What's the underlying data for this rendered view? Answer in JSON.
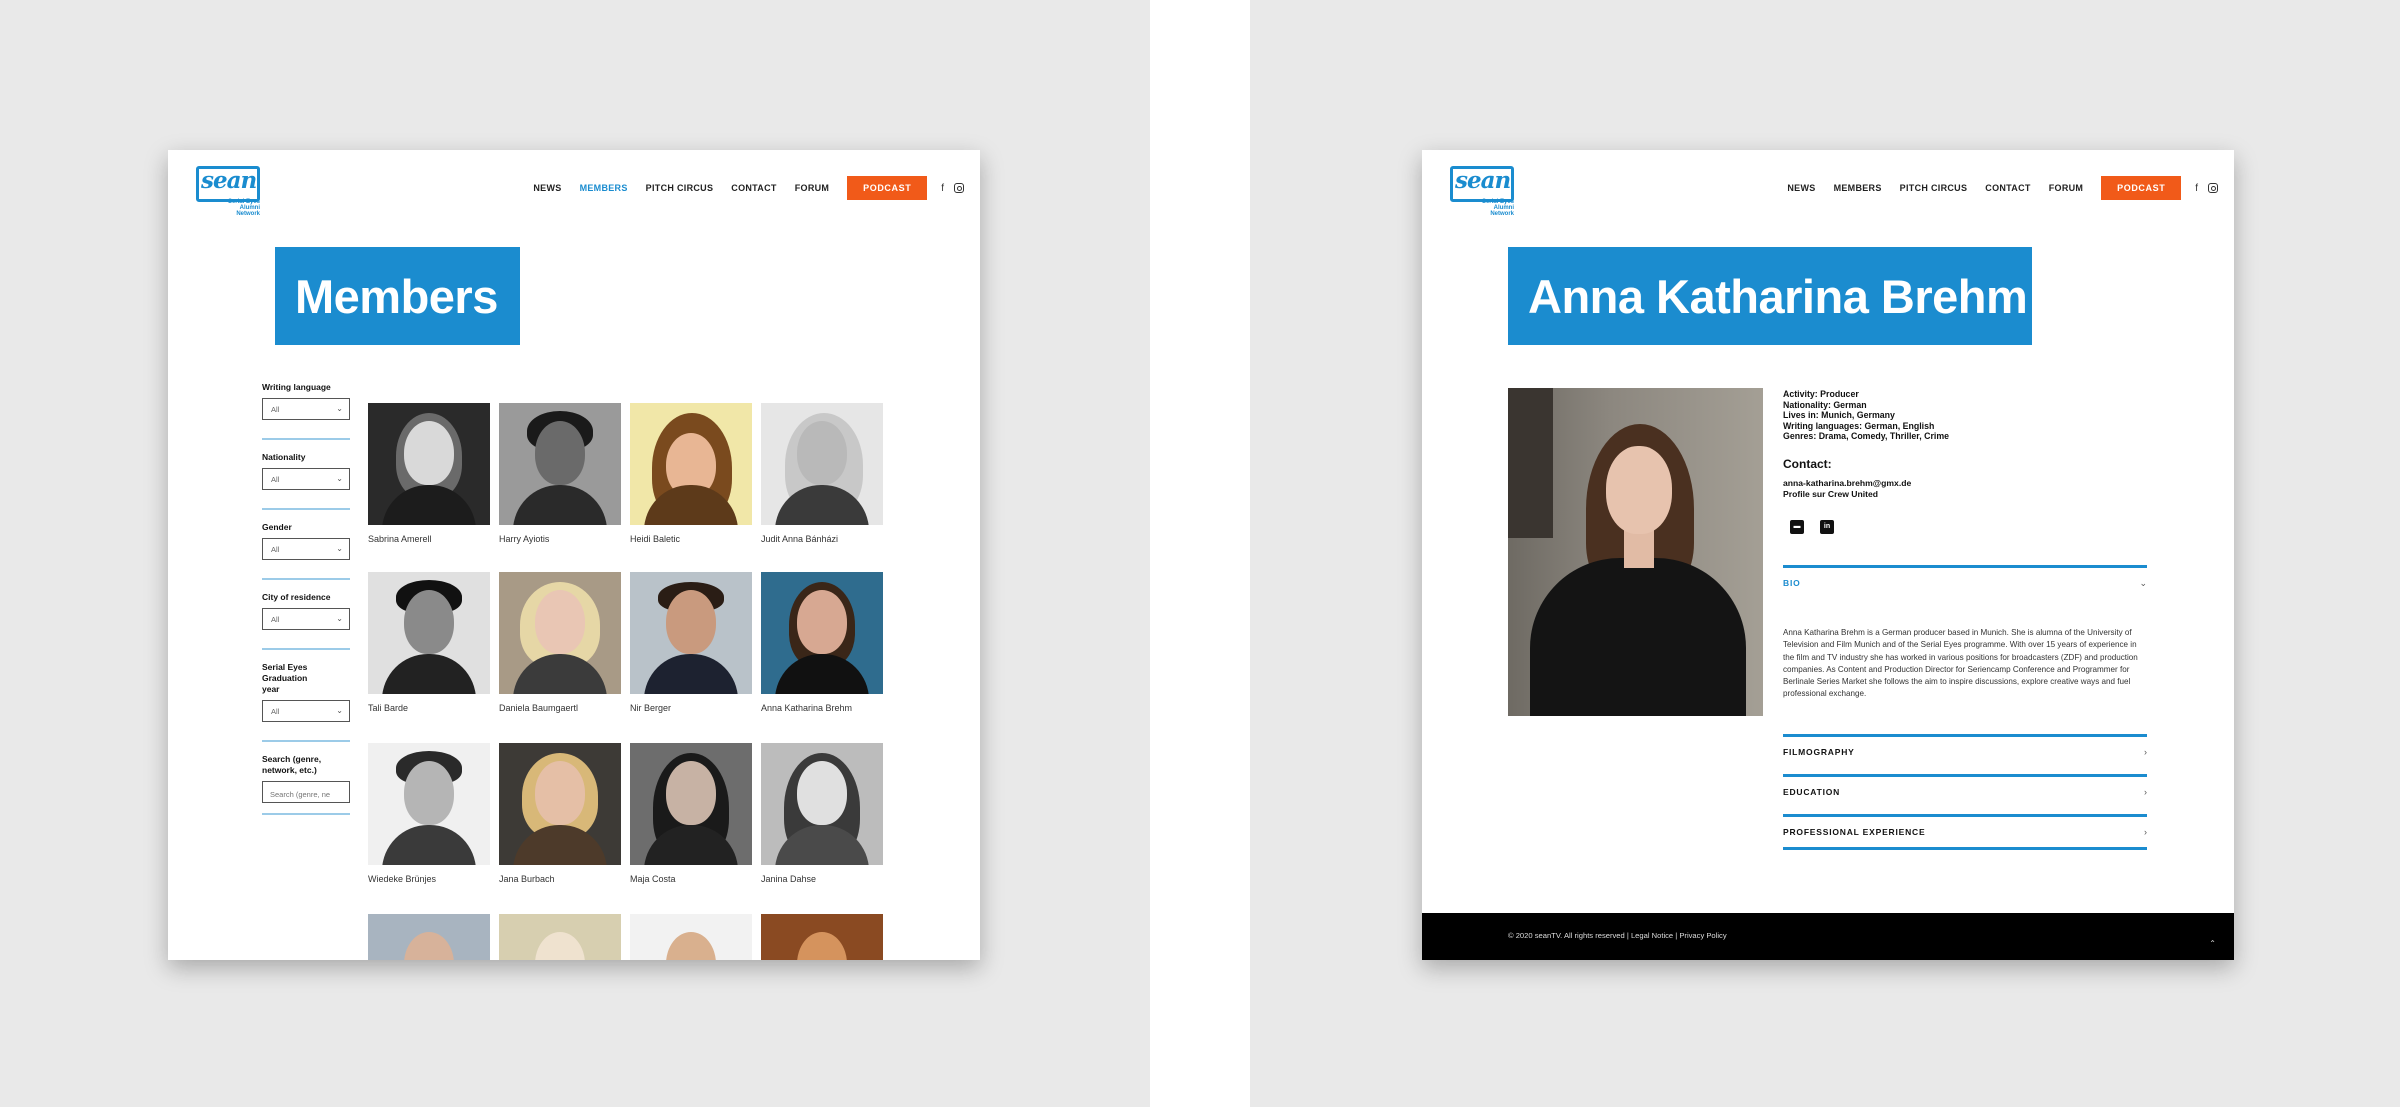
{
  "header": {
    "logo_word": "sean",
    "logo_sub": "Serial Eyes Alumni Network",
    "nav": [
      "NEWS",
      "MEMBERS",
      "PITCH CIRCUS",
      "CONTACT",
      "FORUM"
    ],
    "podcast": "PODCAST",
    "social": [
      "facebook-icon",
      "instagram-icon"
    ]
  },
  "members_page": {
    "title": "Members",
    "filters": {
      "writing_language": {
        "label": "Writing language",
        "value": "All"
      },
      "nationality": {
        "label": "Nationality",
        "value": "All"
      },
      "gender": {
        "label": "Gender",
        "value": "All"
      },
      "city": {
        "label": "City of residence",
        "value": "All"
      },
      "graduation": {
        "label": "Serial Eyes Graduation year",
        "value": "All"
      },
      "search": {
        "label": "Search (genre, network, etc.)",
        "placeholder": "Search (genre, ne"
      }
    },
    "members": [
      {
        "name": "Sabrina Amerell"
      },
      {
        "name": "Harry Ayiotis"
      },
      {
        "name": "Heidi Baletic"
      },
      {
        "name": "Judit Anna Bánházi"
      },
      {
        "name": "Tali Barde"
      },
      {
        "name": "Daniela Baumgaertl"
      },
      {
        "name": "Nir Berger"
      },
      {
        "name": "Anna Katharina Brehm"
      },
      {
        "name": "Wiedeke Brünjes"
      },
      {
        "name": "Jana Burbach"
      },
      {
        "name": "Maja Costa"
      },
      {
        "name": "Janina Dahse"
      },
      {
        "name": ""
      },
      {
        "name": ""
      },
      {
        "name": ""
      },
      {
        "name": ""
      }
    ]
  },
  "profile_page": {
    "title": "Anna Katharina Brehm",
    "facts": {
      "activity": "Activity: Producer",
      "nationality": "Nationality: German",
      "lives_in": "Lives in: Munich, Germany",
      "languages": "Writing languages: German, English",
      "genres": "Genres: Drama, Comedy, Thriller, Crime"
    },
    "contact": {
      "heading": "Contact:",
      "email": "anna-katharina.brehm@gmx.de",
      "crew": "Profile sur Crew United",
      "icons": [
        "imdb-icon",
        "linkedin-icon"
      ]
    },
    "accordion": {
      "bio": "BIO",
      "bio_text": "Anna Katharina Brehm is a German producer based in Munich. She is alumna of the University of Television and Film Munich and of the Serial Eyes programme. With over 15 years of experience in the film and TV industry she has worked in various positions for broadcasters (ZDF) and production companies. As Content and Production Director for Seriencamp Conference and Programmer for Berlinale Series Market she follows the aim to inspire discussions, explore creative ways and fuel professional exchange.",
      "filmography": "FILMOGRAPHY",
      "education": "EDUCATION",
      "experience": "PROFESSIONAL EXPERIENCE"
    },
    "footer": "© 2020 seanTV. All rights reserved | Legal Notice | Privacy Policy"
  },
  "colors": {
    "accent": "#1b8ccf",
    "podcast": "#f15a19",
    "footer": "#000000"
  }
}
